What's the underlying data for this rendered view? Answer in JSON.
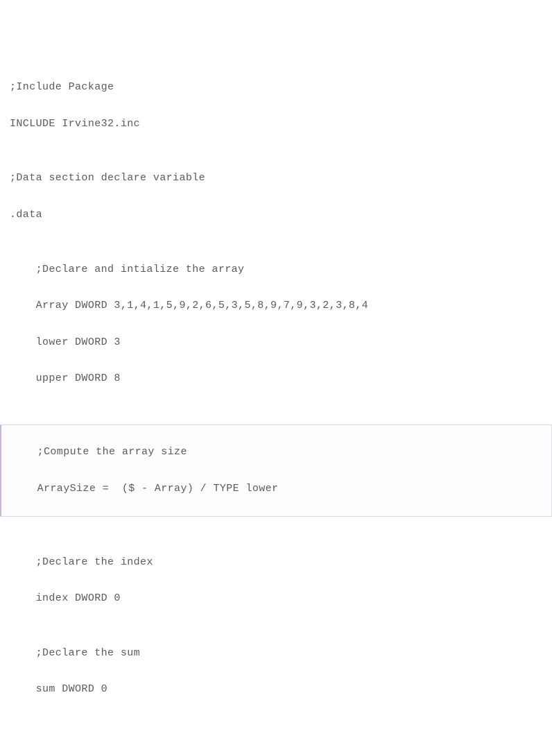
{
  "lines": {
    "l1": ";Include Package",
    "l2": "INCLUDE Irvine32.inc",
    "l3": "",
    "l4": ";Data section declare variable",
    "l5": ".data",
    "l6": "",
    "l7": "    ;Declare and intialize the array",
    "l8": "    Array DWORD 3,1,4,1,5,9,2,6,5,3,5,8,9,7,9,3,2,3,8,4",
    "l9": "    lower DWORD 3",
    "l10": "    upper DWORD 8",
    "l11": "",
    "l12": "    ;Compute the array size",
    "l13": "    ArraySize =  ($ - Array) / TYPE lower",
    "l14": "",
    "l15": "    ;Declare the index",
    "l16": "    index DWORD 0",
    "l17": "",
    "l18": "    ;Declare the sum",
    "l19": "    sum DWORD 0"
  }
}
